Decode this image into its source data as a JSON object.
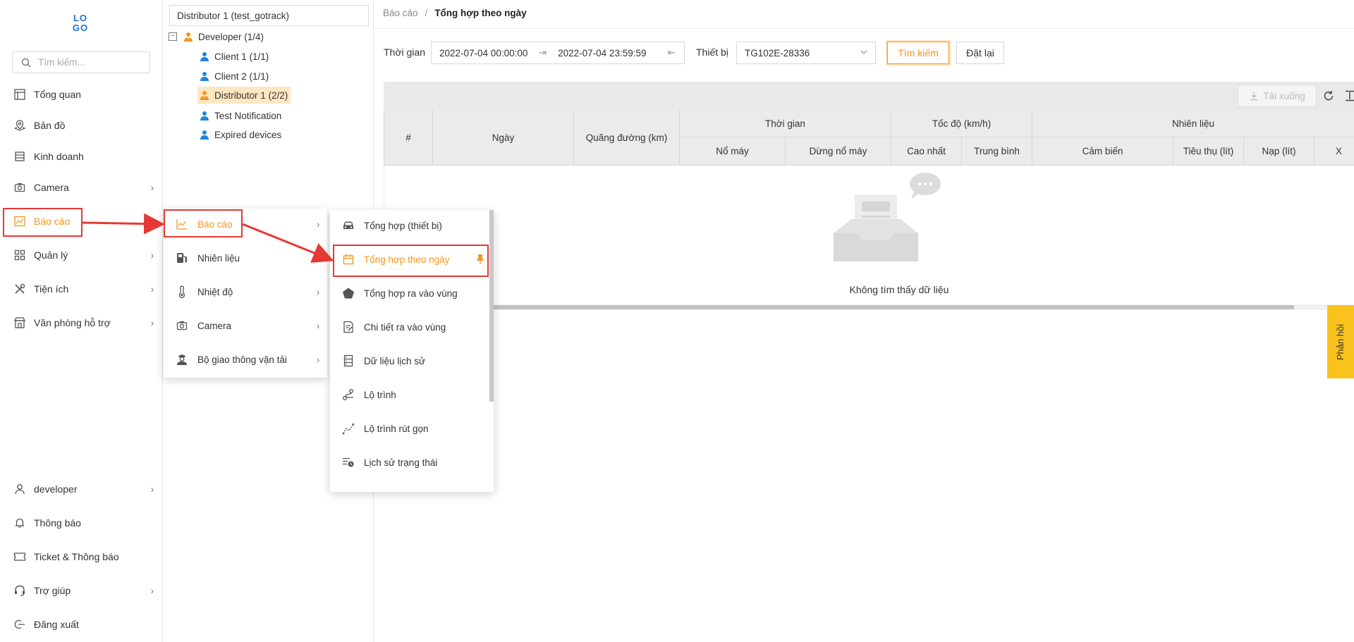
{
  "sidebar": {
    "logo": "LOGO",
    "search_placeholder": "Tìm kiếm...",
    "items": [
      {
        "label": "Tổng quan"
      },
      {
        "label": "Bản đồ"
      },
      {
        "label": "Kinh doanh"
      },
      {
        "label": "Camera",
        "chevron": "›"
      },
      {
        "label": "Báo cáo",
        "chevron": "›"
      },
      {
        "label": "Quản lý",
        "chevron": "›"
      },
      {
        "label": "Tiện ích",
        "chevron": "›"
      },
      {
        "label": "Văn phòng hỗ trợ",
        "chevron": "›"
      }
    ],
    "bottom": [
      {
        "label": "developer",
        "chevron": "›"
      },
      {
        "label": "Thông báo"
      },
      {
        "label": "Ticket & Thông báo"
      },
      {
        "label": "Trợ giúp",
        "chevron": "›"
      },
      {
        "label": "Đăng xuất"
      }
    ]
  },
  "tree": {
    "selector": "Distributor 1 (test_gotrack)",
    "collapse_symbol": "−",
    "nodes": [
      {
        "label": "Developer (1/4)"
      },
      {
        "label": "Client 1 (1/1)"
      },
      {
        "label": "Client 2 (1/1)"
      },
      {
        "label": "Distributor 1 (2/2)"
      },
      {
        "label": "Test Notification"
      },
      {
        "label": "Expired devices"
      }
    ]
  },
  "breadcrumb": {
    "parent": "Báo cáo",
    "separator": "/",
    "current": "Tổng hợp theo ngày"
  },
  "filters": {
    "time_label": "Thời gian",
    "time_from": "2022-07-04 00:00:00",
    "time_to": "2022-07-04 23:59:59",
    "device_label": "Thiết bị",
    "device_value": "TG102E-28336",
    "search_button": "Tìm kiếm",
    "reset_button": "Đặt lại"
  },
  "table": {
    "download_button": "Tải xuống",
    "headers": {
      "index": "#",
      "date": "Ngày",
      "distance": "Quãng đường (km)",
      "time": "Thời gian",
      "engine_on": "Nổ máy",
      "engine_off": "Dừng nổ máy",
      "speed": "Tốc độ (km/h)",
      "speed_max": "Cao nhất",
      "speed_avg": "Trung bình",
      "fuel": "Nhiên liệu",
      "sensor": "Cảm biến",
      "consumption": "Tiêu thụ (lít)",
      "refuel": "Nạp (lít)",
      "more": "X"
    },
    "empty_text": "Không tìm thấy dữ liệu"
  },
  "feedback": "Phản hồi",
  "menu1": {
    "items": [
      {
        "label": "Báo cáo",
        "chevron": "›"
      },
      {
        "label": "Nhiên liệu",
        "chevron": "›"
      },
      {
        "label": "Nhiệt độ",
        "chevron": "›"
      },
      {
        "label": "Camera",
        "chevron": "›"
      },
      {
        "label": "Bộ giao thông vận tải",
        "chevron": "›"
      }
    ]
  },
  "menu2": {
    "items": [
      {
        "label": "Tổng hợp (thiết bị)"
      },
      {
        "label": "Tổng hợp theo ngày"
      },
      {
        "label": "Tổng hợp ra vào vùng"
      },
      {
        "label": "Chi tiết ra vào vùng"
      },
      {
        "label": "Dữ liệu lịch sử"
      },
      {
        "label": "Lộ trình"
      },
      {
        "label": "Lộ trình rút gọn"
      },
      {
        "label": "Lịch sử trạng thái"
      }
    ]
  },
  "colors": {
    "accent": "#f5941f",
    "highlight": "#e53935",
    "user_icon": "#1f86e0",
    "feedback": "#f9c21c"
  }
}
